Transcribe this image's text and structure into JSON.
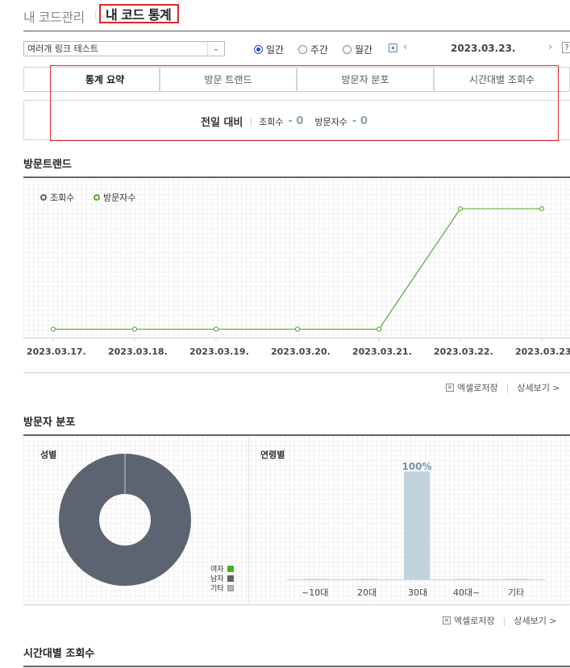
{
  "breadcrumb": {
    "parent": "내 코드관리",
    "current": "내 코드 통계"
  },
  "controls": {
    "code_select": "여러개 링크 테스트",
    "periods": [
      {
        "label": "일간",
        "selected": true
      },
      {
        "label": "주간",
        "selected": false
      },
      {
        "label": "월간",
        "selected": false
      }
    ],
    "date": "2023.03.23.",
    "prev_icon": "chevron-left-icon",
    "next_icon": "chevron-right-icon",
    "help": "?"
  },
  "tabs": [
    "통계 요약",
    "방문 트랜드",
    "방문자 분포",
    "시간대별 조회수"
  ],
  "summary": {
    "label": "전일 대비",
    "views_label": "조회수",
    "views_value": "- 0",
    "visitors_label": "방문자수",
    "visitors_value": "- 0"
  },
  "trend": {
    "title": "방문트랜드",
    "legend": [
      {
        "name": "조회수",
        "color": "#5b6470"
      },
      {
        "name": "방문자수",
        "color": "#4caf1e"
      }
    ],
    "dates": [
      "2023.03.17.",
      "2023.03.18.",
      "2023.03.19.",
      "2023.03.20.",
      "2023.03.21.",
      "2023.03.22.",
      "2023.03.23."
    ]
  },
  "actions": {
    "excel": "엑셀로저장",
    "detail": "상세보기 >"
  },
  "distribution": {
    "title": "방문자 분포",
    "gender_title": "성별",
    "gender_legend": [
      {
        "name": "여자",
        "color": "#4caf1e"
      },
      {
        "name": "남자",
        "color": "#5b6470"
      },
      {
        "name": "기타",
        "color": "#b5b5b5"
      }
    ],
    "age_title": "연령별",
    "age_labels": [
      "~10대",
      "20대",
      "30대",
      "40대~",
      "기타"
    ],
    "age_peak_label": "100%"
  },
  "hourly": {
    "title": "시간대별 조회수"
  },
  "chart_data": [
    {
      "type": "line",
      "x": [
        "2023.03.17.",
        "2023.03.18.",
        "2023.03.19.",
        "2023.03.20.",
        "2023.03.21.",
        "2023.03.22.",
        "2023.03.23."
      ],
      "series": [
        {
          "name": "조회수",
          "values": [
            0,
            0,
            0,
            0,
            0,
            1,
            1
          ]
        },
        {
          "name": "방문자수",
          "values": [
            0,
            0,
            0,
            0,
            0,
            1,
            1
          ]
        }
      ],
      "ylim": [
        0,
        1.1
      ],
      "grid": true,
      "legend": "top-left"
    },
    {
      "type": "pie",
      "labels": [
        "여자",
        "남자",
        "기타"
      ],
      "values": [
        0,
        100,
        0
      ],
      "legend": "bottom-right"
    },
    {
      "type": "bar",
      "categories": [
        "~10대",
        "20대",
        "30대",
        "40대~",
        "기타"
      ],
      "values": [
        0,
        0,
        100,
        0,
        0
      ],
      "ylim": [
        0,
        100
      ],
      "data_labels": [
        "",
        "",
        "100%",
        "",
        ""
      ]
    }
  ]
}
